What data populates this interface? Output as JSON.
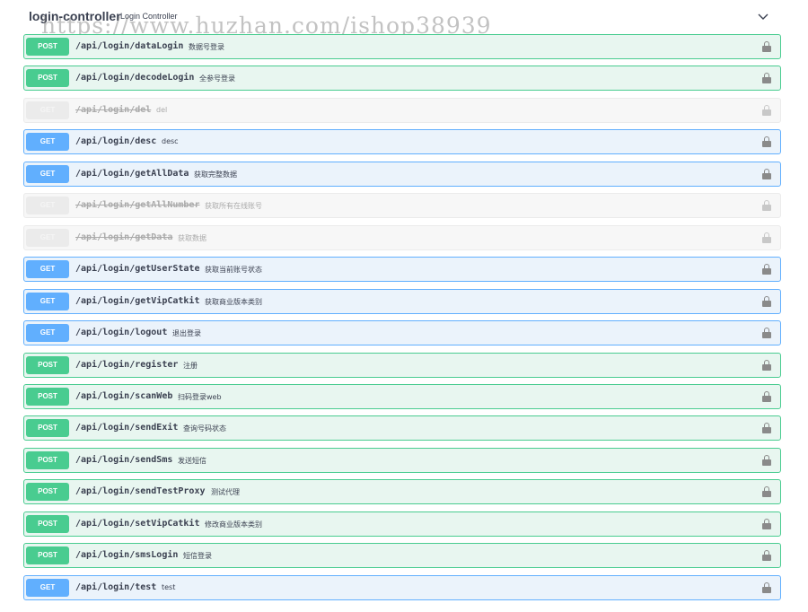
{
  "header": {
    "title": "login-controller",
    "subtitle": "Login Controller",
    "watermark": "https://www.huzhan.com/ishop38939"
  },
  "operations": [
    {
      "method": "POST",
      "path": "/api/login/dataLogin",
      "summary": "数据号登录",
      "deprecated": false
    },
    {
      "method": "POST",
      "path": "/api/login/decodeLogin",
      "summary": "全参号登录",
      "deprecated": false
    },
    {
      "method": "GET",
      "path": "/api/login/del",
      "summary": "del",
      "deprecated": true
    },
    {
      "method": "GET",
      "path": "/api/login/desc",
      "summary": "desc",
      "deprecated": false
    },
    {
      "method": "GET",
      "path": "/api/login/getAllData",
      "summary": "获取完整数据",
      "deprecated": false
    },
    {
      "method": "GET",
      "path": "/api/login/getAllNumber",
      "summary": "获取所有在线账号",
      "deprecated": true
    },
    {
      "method": "GET",
      "path": "/api/login/getData",
      "summary": "获取数据",
      "deprecated": true
    },
    {
      "method": "GET",
      "path": "/api/login/getUserState",
      "summary": "获取当前账号状态",
      "deprecated": false
    },
    {
      "method": "GET",
      "path": "/api/login/getVipCatkit",
      "summary": "获取商业版本类别",
      "deprecated": false
    },
    {
      "method": "GET",
      "path": "/api/login/logout",
      "summary": "退出登录",
      "deprecated": false
    },
    {
      "method": "POST",
      "path": "/api/login/register",
      "summary": "注册",
      "deprecated": false
    },
    {
      "method": "POST",
      "path": "/api/login/scanWeb",
      "summary": "扫码登录web",
      "deprecated": false
    },
    {
      "method": "POST",
      "path": "/api/login/sendExit",
      "summary": "查询号码状态",
      "deprecated": false
    },
    {
      "method": "POST",
      "path": "/api/login/sendSms",
      "summary": "发送短信",
      "deprecated": false
    },
    {
      "method": "POST",
      "path": "/api/login/sendTestProxy",
      "summary": "测试代理",
      "deprecated": false
    },
    {
      "method": "POST",
      "path": "/api/login/setVipCatkit",
      "summary": "修改商业版本类别",
      "deprecated": false
    },
    {
      "method": "POST",
      "path": "/api/login/smsLogin",
      "summary": "短信登录",
      "deprecated": false
    },
    {
      "method": "GET",
      "path": "/api/login/test",
      "summary": "test",
      "deprecated": false
    }
  ],
  "icons": {
    "collapse": "chevron-down-icon",
    "auth": "lock-icon"
  },
  "colors": {
    "post": "#49cc90",
    "get": "#61affe",
    "deprecated": "#ebebeb"
  }
}
